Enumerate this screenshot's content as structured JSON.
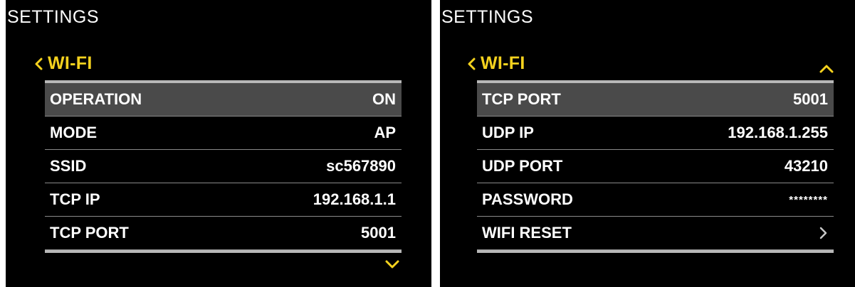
{
  "colors": {
    "accent": "#f5d21e",
    "background": "#000000",
    "selected_row": "#4a4a4a",
    "text": "#ffffff"
  },
  "left_screen": {
    "title": "SETTINGS",
    "back_label": "WI-FI",
    "rows": [
      {
        "label": "OPERATION",
        "value": "ON",
        "selected": true
      },
      {
        "label": "MODE",
        "value": "AP"
      },
      {
        "label": "SSID",
        "value": "sc567890"
      },
      {
        "label": "TCP IP",
        "value": "192.168.1.1"
      },
      {
        "label": "TCP PORT",
        "value": "5001"
      }
    ],
    "scroll_icon": "chevron-down-icon"
  },
  "right_screen": {
    "title": "SETTINGS",
    "back_label": "WI-FI",
    "rows": [
      {
        "label": "TCP PORT",
        "value": "5001",
        "selected": true
      },
      {
        "label": "UDP IP",
        "value": "192.168.1.255"
      },
      {
        "label": "UDP PORT",
        "value": "43210"
      },
      {
        "label": "PASSWORD",
        "value": "********"
      },
      {
        "label": "WIFI RESET",
        "value": "",
        "icon": "chevron-right-icon"
      }
    ],
    "scroll_icon": "chevron-up-icon"
  }
}
